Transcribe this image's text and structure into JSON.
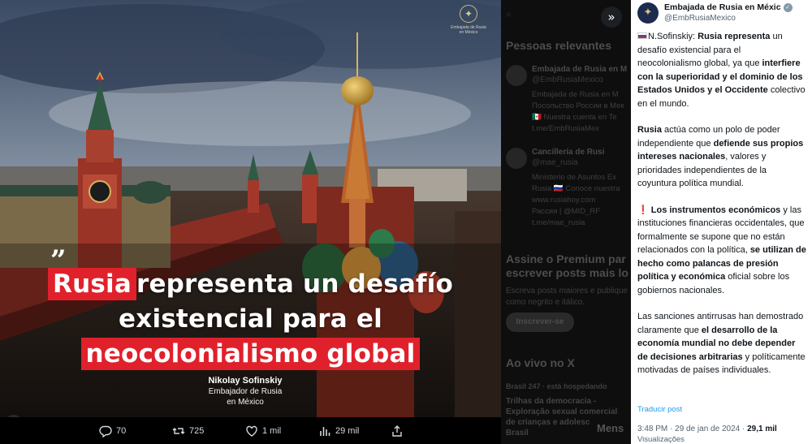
{
  "media": {
    "seal_text_line1": "Embajada de Rusia",
    "seal_text_line2": "en México",
    "quote_mark": "”",
    "headline": {
      "line1_highlight": "Rusia",
      "line1_rest": " representa un desafío",
      "line2": "existencial para el",
      "line3_highlight": "neocolonialismo global"
    },
    "author_name": "Nikolay Sofinskiy",
    "author_role_line1": "Embajador de Rusia",
    "author_role_line2": "en México",
    "accent_color": "#e0212b"
  },
  "actions": {
    "reply_count": "70",
    "repost_count": "725",
    "like_count": "1 mil",
    "views_count": "29 mil"
  },
  "sidebar": {
    "relevant_title": "Pessoas relevantes",
    "accounts": [
      {
        "name": "Embajada de Rusia en M",
        "handle": "@EmbRusiaMexico",
        "bio": [
          "Embajada de Rusia en M",
          "Посольство России в Мек",
          "🇲🇽 Nuestra cuenta en Te",
          "t.me/EmbRusiaMex"
        ]
      },
      {
        "name": "Cancillería de Rusi",
        "handle": "@mae_rusia",
        "bio": [
          "Ministerio de Asuntos Ex",
          "Rusia 🇷🇺 Conoce nuestra",
          "www.rusiahoy.com",
          "Рассия | @MID_RF",
          "t.me/mae_rusia"
        ]
      }
    ],
    "premium_title_line1": "Assine o Premium par",
    "premium_title_line2": "escrever posts mais lo",
    "premium_desc_line1": "Escreva posts maiores e publique",
    "premium_desc_line2": "como negrito e itálico.",
    "premium_button": "Inscrever-se",
    "live_title": "Ao vivo no X",
    "trend_source": "Brasil 247 · está hospedando",
    "trend_title_line1": "Trilhas da democracia -",
    "trend_title_line2": "Exploração sexual comercial",
    "trend_title_line3": "de crianças e adolesc",
    "trend_title_line4": "Brasil",
    "messages_label": "Mens"
  },
  "tweet": {
    "display_name": "Embajada de Rusia en Méxic",
    "handle": "@EmbRusiaMexico",
    "p1_prefix": "N.Sofinskiy: ",
    "p1_b1": "Rusia representa",
    "p1_t1": " un desafío existencial para el neocolonialismo global, ya que ",
    "p1_b2": "interfiere con la superioridad y el dominio de los Estados Unidos y el Occidente",
    "p1_t2": " colectivo en el mundo.",
    "p2_b1": "Rusia",
    "p2_t1": " actúa como un polo de poder independiente que ",
    "p2_b2": "defiende sus propios intereses nacionales",
    "p2_t2": ", valores y prioridades independientes de la coyuntura política mundial.",
    "p3_excl": "❗",
    "p3_b1": "Los instrumentos económicos",
    "p3_t1": " y las instituciones financieras occidentales, que formalmente se supone que no están relacionados con la política, ",
    "p3_b2": "se utilizan de hecho como palancas de presión política y económica",
    "p3_t2": " oficial sobre los gobiernos nacionales.",
    "p4_t1": "Las sanciones antirrusas han demostrado claramente que ",
    "p4_b1": "el desarrollo de la economía mundial no debe depender de decisiones arbitrarias",
    "p4_t2": " y políticamente motivadas de países individuales.",
    "translate": "Traducir post",
    "timestamp": "3:48 PM · 29 de jan de 2024 · ",
    "views_number": "29,1 mil",
    "views_label": "Visualizações",
    "link_color": "#1d9bf0"
  }
}
